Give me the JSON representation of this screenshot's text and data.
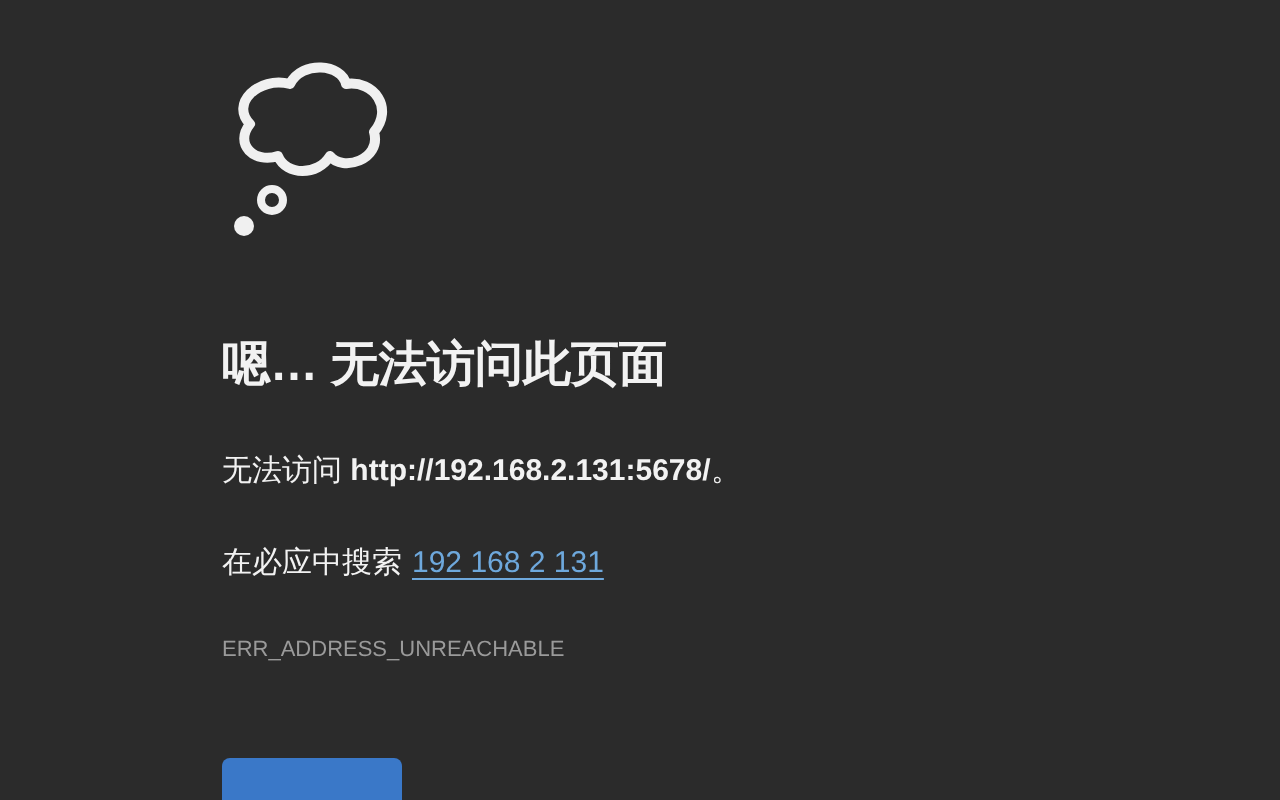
{
  "title": "嗯… 无法访问此页面",
  "message": "无法访问 **http://192.168.2.131:5678/**。",
  "search": {
    "label": "在必应中搜索",
    "link": "192 168 2 131"
  },
  "error_code": "ERR_ADDRESS_UNREACHABLE"
}
